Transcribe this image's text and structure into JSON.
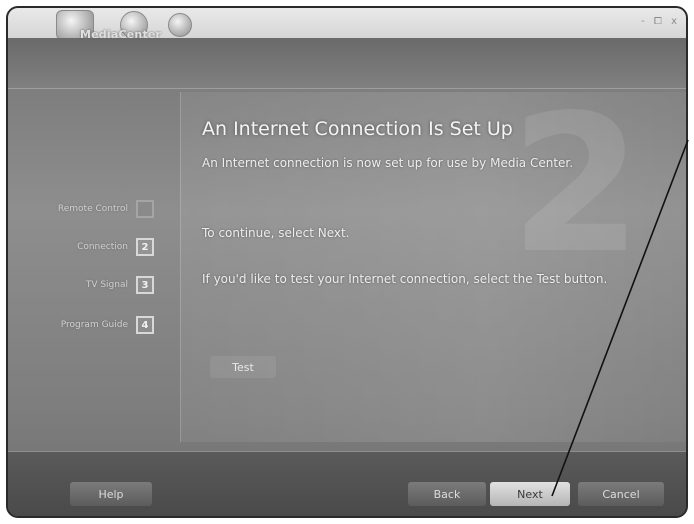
{
  "app": {
    "logo_text": "MediaCenter",
    "window_controls": "- ⧠ x"
  },
  "wizard": {
    "watermark_step_number": "2",
    "heading": "An Internet Connection Is Set Up",
    "paragraphs": [
      "An Internet connection is now set up for use by Media Center.",
      "To continue, select Next.",
      "If you'd like to test your Internet connection, select the Test button."
    ],
    "test_label": "Test"
  },
  "steps": [
    {
      "label": "Remote Control",
      "number": "",
      "done": true
    },
    {
      "label": "Connection",
      "number": "2",
      "done": false
    },
    {
      "label": "TV Signal",
      "number": "3",
      "done": false
    },
    {
      "label": "Program Guide",
      "number": "4",
      "done": false
    }
  ],
  "buttons": {
    "help": "Help",
    "back": "Back",
    "next": "Next",
    "cancel": "Cancel"
  },
  "colors": {
    "background": "#808080",
    "accent": "#e2e2e2",
    "callout_line": "#111111"
  }
}
